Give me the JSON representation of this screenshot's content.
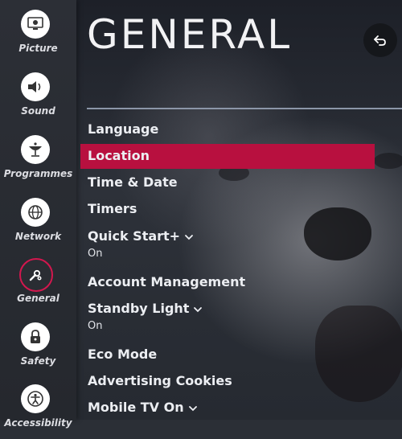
{
  "page": {
    "title": "GENERAL"
  },
  "sidebar": {
    "items": [
      {
        "label": "Picture",
        "icon": "picture-icon"
      },
      {
        "label": "Sound",
        "icon": "speaker-icon"
      },
      {
        "label": "Programmes",
        "icon": "satellite-dish-icon"
      },
      {
        "label": "Network",
        "icon": "globe-icon"
      },
      {
        "label": "General",
        "icon": "wrench-gear-icon",
        "active": true
      },
      {
        "label": "Safety",
        "icon": "lock-icon"
      },
      {
        "label": "Accessibility",
        "icon": "accessibility-icon"
      }
    ]
  },
  "menu": {
    "items": [
      {
        "label": "Language"
      },
      {
        "label": "Location",
        "selected": true
      },
      {
        "label": "Time & Date"
      },
      {
        "label": "Timers"
      },
      {
        "label": "Quick Start+",
        "value": "On",
        "expandable": true
      },
      {
        "label": "Account Management"
      },
      {
        "label": "Standby Light",
        "value": "On",
        "expandable": true
      },
      {
        "label": "Eco Mode"
      },
      {
        "label": "Advertising Cookies"
      },
      {
        "label": "Mobile TV On",
        "expandable": true
      }
    ]
  },
  "colors": {
    "accent": "#b8103f",
    "active_ring": "#d3174e",
    "divider": "#8c96a8"
  }
}
